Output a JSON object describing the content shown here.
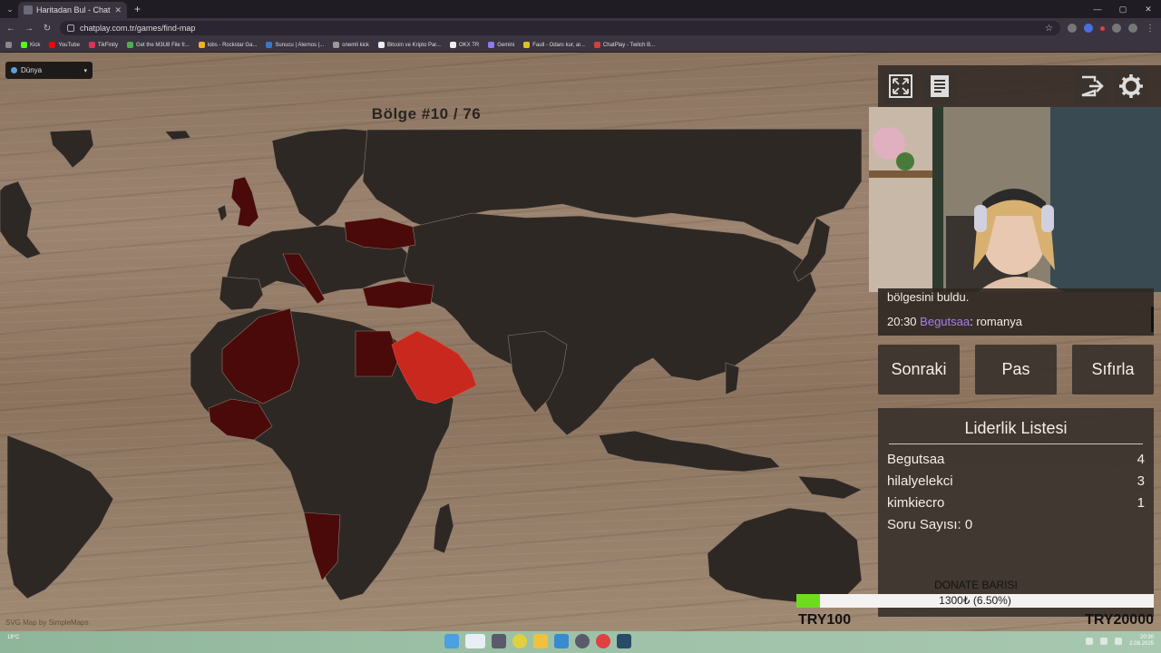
{
  "browser": {
    "tab_title": "Haritadan Bul - ChatPlay",
    "url": "chatplay.com.tr/games/find-map",
    "bookmarks": [
      "Kick",
      "YouTube",
      "TikFinity",
      "Get the M3U8 File fr...",
      "lobs - Rockstar Ga...",
      "Sunucu | Aternos |...",
      "onemli kick",
      "Bitcoin ve Kripto Par...",
      "OKX TR",
      "Gemini",
      "Faull - Odanı kur, ar...",
      "ChatPlay - Twitch B..."
    ]
  },
  "game": {
    "region_select": "Dünya",
    "map_title": "Bölge #10 / 76",
    "map_credit": "SVG Map by SimpleMaps",
    "highlight_colors": {
      "found": "#4a0a0a",
      "current": "#c8281e",
      "land": "#2e2825"
    }
  },
  "chat": {
    "line1": "bölgesini buldu.",
    "line2_time": "20:30",
    "line2_user": "Begutsaa",
    "line2_sep": ":",
    "line2_msg": " romanya"
  },
  "buttons": {
    "next": "Sonraki",
    "pass": "Pas",
    "reset": "Sıfırla"
  },
  "leaderboard": {
    "title": "Liderlik Listesi",
    "rows": [
      {
        "name": "Begutsaa",
        "score": "4"
      },
      {
        "name": "hilalyelekci",
        "score": "3"
      },
      {
        "name": "kimkiecro",
        "score": "1"
      }
    ],
    "question_count": "Soru Sayısı: 0"
  },
  "donate": {
    "title": "DONATE BARISI",
    "progress_text": "1300₺ (6.50%)",
    "progress": 0.065,
    "min": "TRY100",
    "max": "TRY20000"
  },
  "taskbar": {
    "weather": "18°C",
    "clock_time": "20:30",
    "clock_date": "2.08.2025"
  }
}
